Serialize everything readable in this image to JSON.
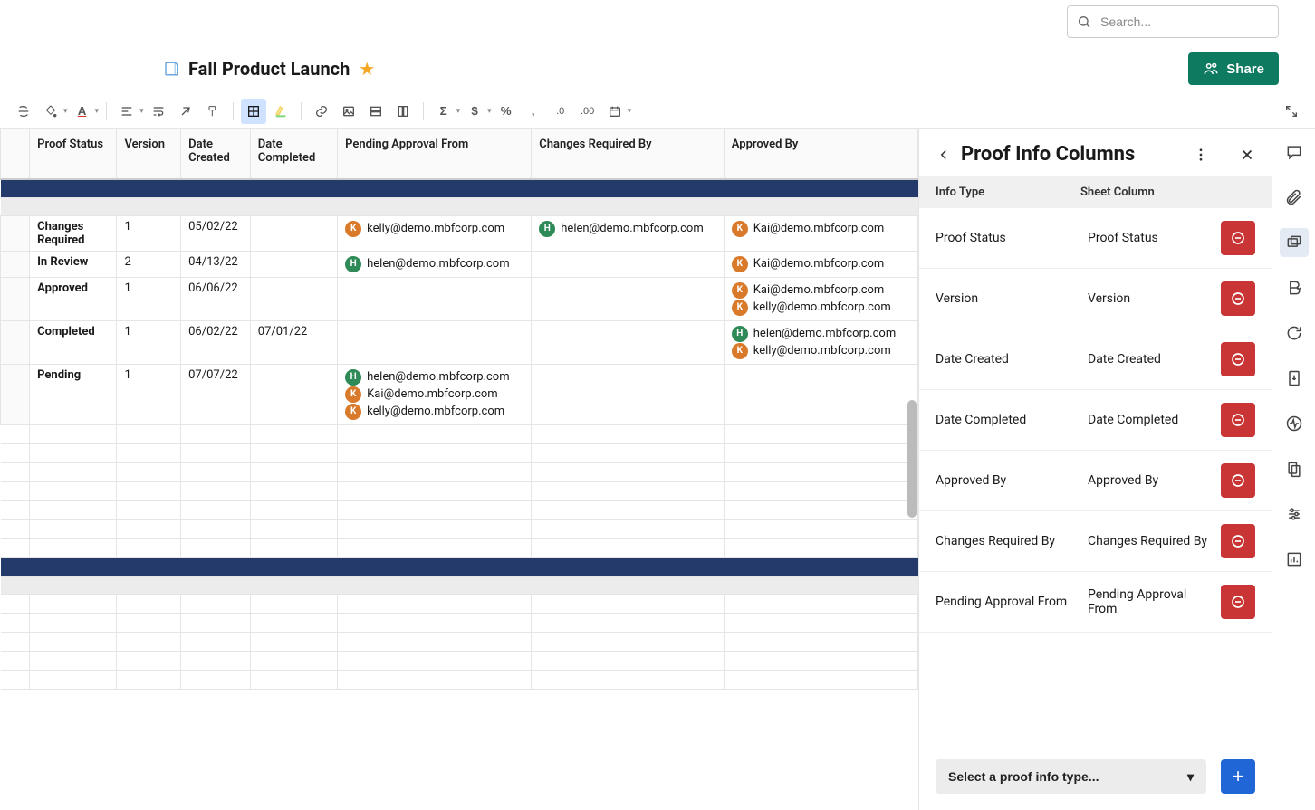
{
  "search": {
    "placeholder": "Search..."
  },
  "title": "Fall Product Launch",
  "share": "Share",
  "columns": [
    "Proof Status",
    "Version",
    "Date Created",
    "Date Completed",
    "Pending Approval From",
    "Changes Required By",
    "Approved By"
  ],
  "rows": [
    {
      "status": "Changes Required",
      "version": "1",
      "created": "05/02/22",
      "completed": "",
      "pending": [
        "kelly@demo.mbfcorp.com"
      ],
      "changes": [
        "helen@demo.mbfcorp.com"
      ],
      "approved": [
        "Kai@demo.mbfcorp.com"
      ]
    },
    {
      "status": "In Review",
      "version": "2",
      "created": "04/13/22",
      "completed": "",
      "pending": [
        "helen@demo.mbfcorp.com"
      ],
      "changes": [],
      "approved": [
        "Kai@demo.mbfcorp.com"
      ]
    },
    {
      "status": "Approved",
      "version": "1",
      "created": "06/06/22",
      "completed": "",
      "pending": [],
      "changes": [],
      "approved": [
        "Kai@demo.mbfcorp.com",
        "kelly@demo.mbfcorp.com"
      ]
    },
    {
      "status": "Completed",
      "version": "1",
      "created": "06/02/22",
      "completed": "07/01/22",
      "pending": [],
      "changes": [],
      "approved": [
        "helen@demo.mbfcorp.com",
        "kelly@demo.mbfcorp.com"
      ]
    },
    {
      "status": "Pending",
      "version": "1",
      "created": "07/07/22",
      "completed": "",
      "pending": [
        "helen@demo.mbfcorp.com",
        "Kai@demo.mbfcorp.com",
        "kelly@demo.mbfcorp.com"
      ],
      "changes": [],
      "approved": []
    }
  ],
  "panel": {
    "title": "Proof Info Columns",
    "head_info": "Info Type",
    "head_sheet": "Sheet Column",
    "mappings": [
      {
        "info": "Proof Status",
        "sheet": "Proof Status"
      },
      {
        "info": "Version",
        "sheet": "Version"
      },
      {
        "info": "Date Created",
        "sheet": "Date Created"
      },
      {
        "info": "Date Completed",
        "sheet": "Date Completed"
      },
      {
        "info": "Approved By",
        "sheet": "Approved By"
      },
      {
        "info": "Changes Required By",
        "sheet": "Changes Required By"
      },
      {
        "info": "Pending Approval From",
        "sheet": "Pending Approval From"
      }
    ],
    "select": "Select a proof info type..."
  }
}
